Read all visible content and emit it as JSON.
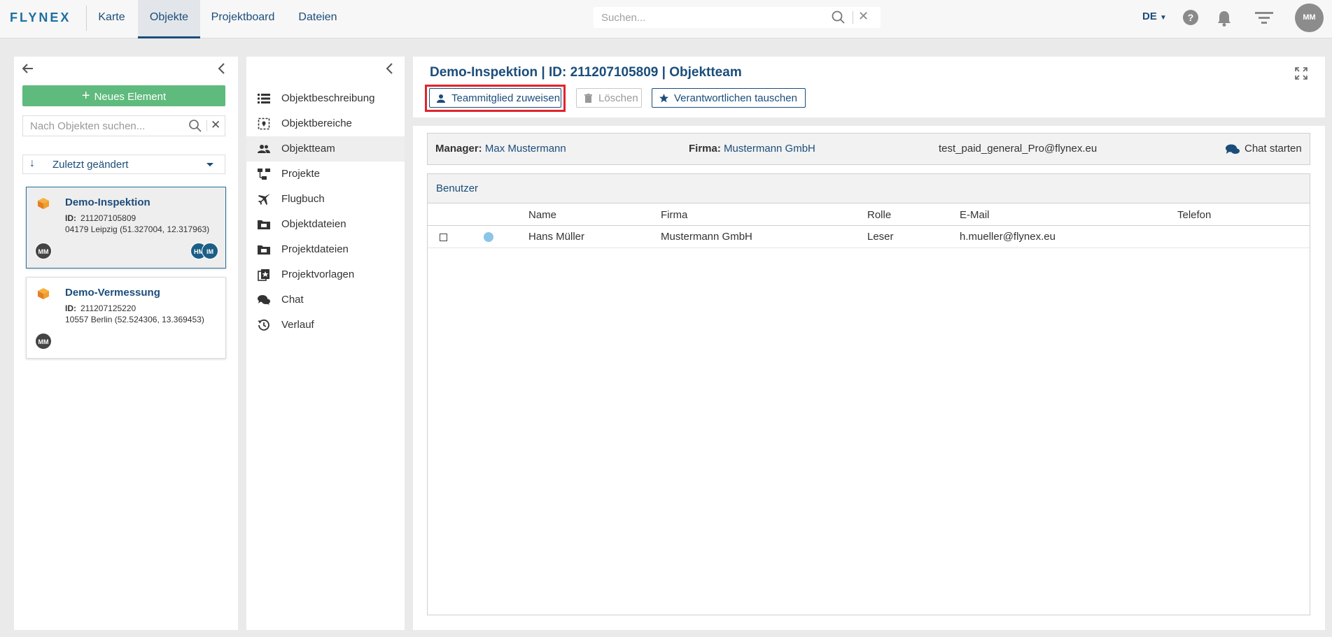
{
  "topbar": {
    "logo": "FLYNEX",
    "nav": [
      "Karte",
      "Objekte",
      "Projektboard",
      "Dateien"
    ],
    "active_nav": "Objekte",
    "search_placeholder": "Suchen...",
    "language": "DE",
    "user_initials": "MM"
  },
  "objects_panel": {
    "new_button": "Neues Element",
    "search_placeholder": "Nach Objekten suchen...",
    "sort_label": "Zuletzt geändert",
    "items": [
      {
        "title": "Demo-Inspektion",
        "id_label": "ID:",
        "id": "211207105809",
        "location": "04179 Leipzig (51.327004, 12.317963)",
        "owner": "MM",
        "members": [
          "HM",
          "IM"
        ]
      },
      {
        "title": "Demo-Vermessung",
        "id_label": "ID:",
        "id": "211207125220",
        "location": "10557 Berlin (52.524306, 13.369453)",
        "owner": "MM",
        "members": []
      }
    ]
  },
  "menu": {
    "items": [
      {
        "label": "Objektbeschreibung",
        "icon": "list-icon"
      },
      {
        "label": "Objektbereiche",
        "icon": "area-icon"
      },
      {
        "label": "Objektteam",
        "icon": "team-icon"
      },
      {
        "label": "Projekte",
        "icon": "projects-icon"
      },
      {
        "label": "Flugbuch",
        "icon": "plane-icon"
      },
      {
        "label": "Objektdateien",
        "icon": "folder-icon"
      },
      {
        "label": "Projektdateien",
        "icon": "folder-icon"
      },
      {
        "label": "Projektvorlagen",
        "icon": "template-icon"
      },
      {
        "label": "Chat",
        "icon": "chat-icon"
      },
      {
        "label": "Verlauf",
        "icon": "history-icon"
      }
    ],
    "active": "Objektteam"
  },
  "main": {
    "title": "Demo-Inspektion | ID: 211207105809 | Objektteam",
    "buttons": {
      "assign": "Teammitglied zuweisen",
      "delete": "Löschen",
      "swap": "Verantwortlichen tauschen"
    },
    "info": {
      "manager_label": "Manager:",
      "manager": "Max Mustermann",
      "company_label": "Firma:",
      "company": "Mustermann GmbH",
      "email": "test_paid_general_Pro@flynex.eu",
      "chat": "Chat starten"
    },
    "table": {
      "caption": "Benutzer",
      "columns": [
        "Name",
        "Firma",
        "Rolle",
        "E-Mail",
        "Telefon"
      ],
      "rows": [
        {
          "name": "Hans Müller",
          "firma": "Mustermann GmbH",
          "rolle": "Leser",
          "email": "h.mueller@flynex.eu",
          "telefon": ""
        }
      ]
    }
  },
  "colors": {
    "brand": "#1b4d7a",
    "success": "#5fba7d",
    "highlight": "#e0242c",
    "accent_orange": "#f0a030"
  }
}
